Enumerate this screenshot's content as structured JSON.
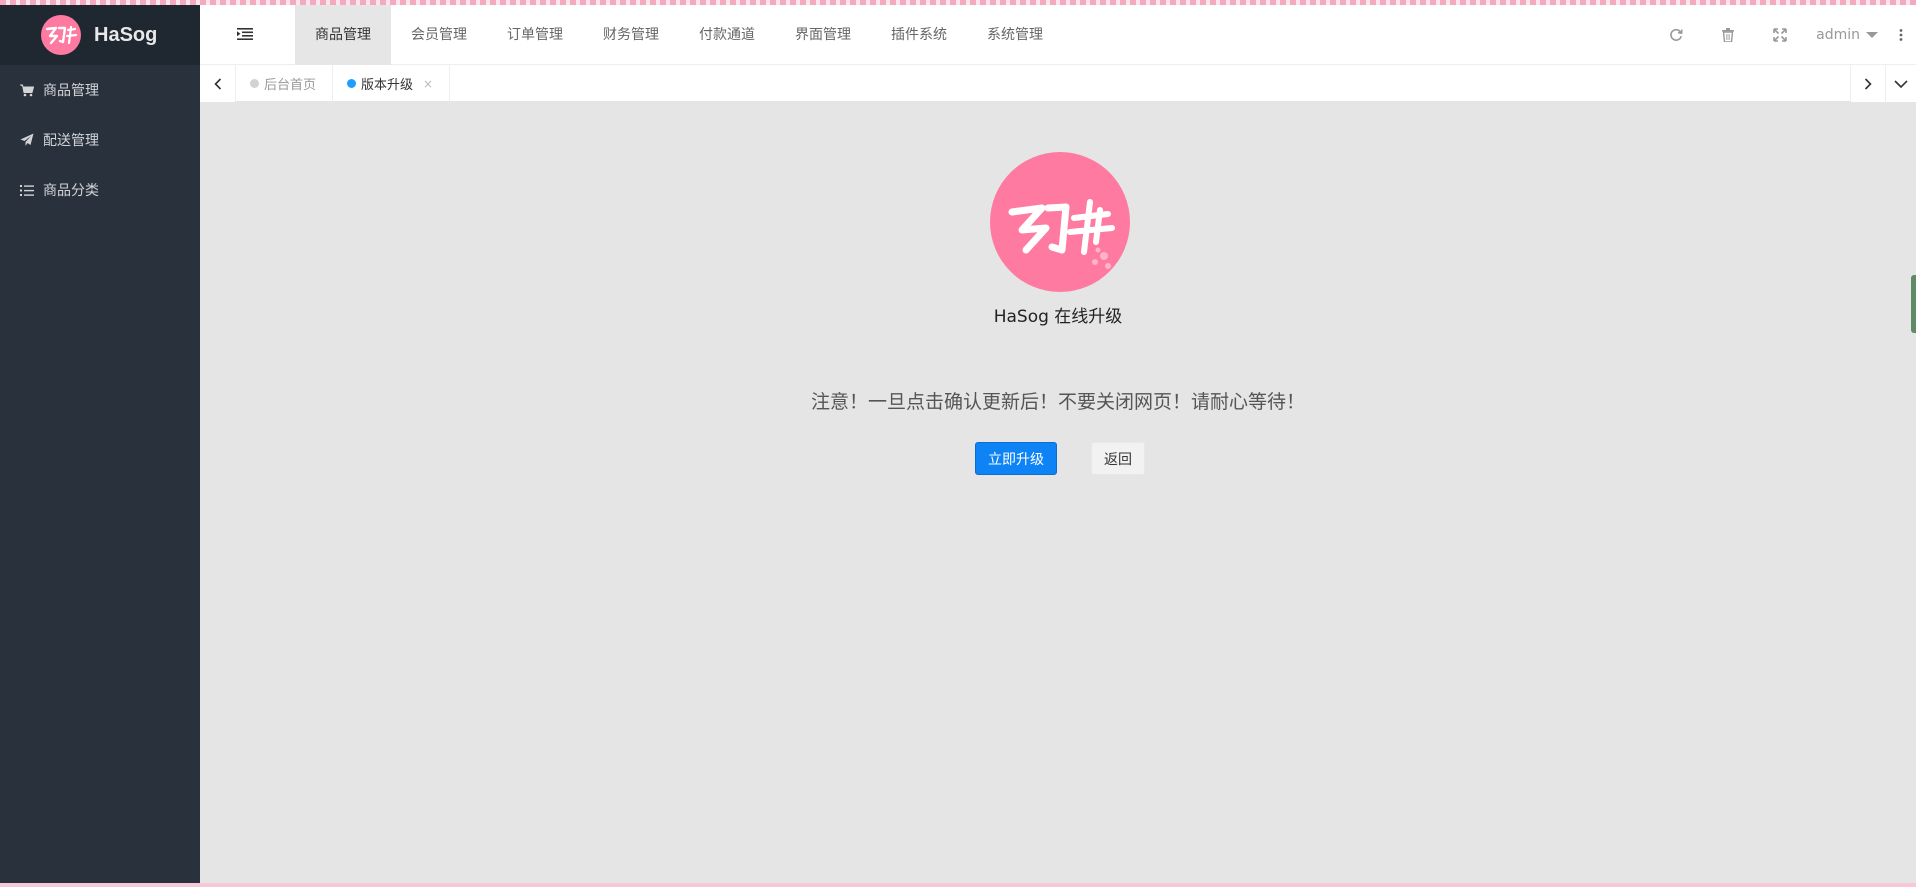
{
  "app": {
    "name": "HaSog",
    "logo_text": "幻神",
    "logo_subtext": "Hasog",
    "brand_color": "#ff7aa1"
  },
  "sidebar": {
    "items": [
      {
        "label": "商品管理",
        "icon": "cart-icon"
      },
      {
        "label": "配送管理",
        "icon": "paper-plane-icon"
      },
      {
        "label": "商品分类",
        "icon": "list-icon"
      }
    ]
  },
  "header": {
    "nav": [
      {
        "label": "商品管理",
        "active": true
      },
      {
        "label": "会员管理"
      },
      {
        "label": "订单管理"
      },
      {
        "label": "财务管理"
      },
      {
        "label": "付款通道"
      },
      {
        "label": "界面管理"
      },
      {
        "label": "插件系统"
      },
      {
        "label": "系统管理"
      }
    ],
    "user": "admin"
  },
  "tabs": [
    {
      "label": "后台首页",
      "active": false
    },
    {
      "label": "版本升级",
      "active": true,
      "close": "×"
    }
  ],
  "main": {
    "title": "HaSog 在线升级",
    "notice": "注意！一旦点击确认更新后！不要关闭网页！请耐心等待！",
    "primary_button": "立即升级",
    "back_button": "返回",
    "primary_color": "#0d83f5"
  }
}
